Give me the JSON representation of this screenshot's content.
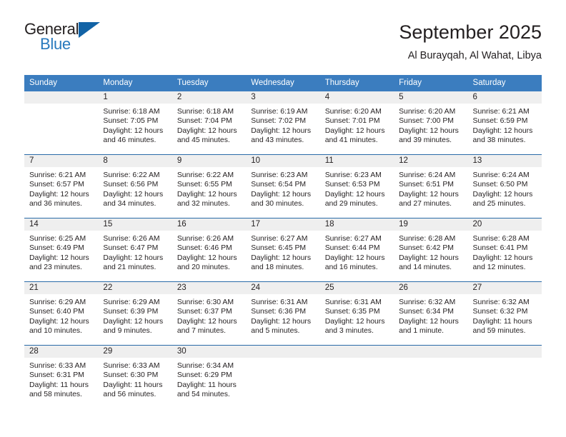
{
  "brand": {
    "name_part1": "General",
    "name_part2": "Blue",
    "logo_icon": "blue-triangle-icon",
    "colors": {
      "general_text": "#231f20",
      "blue_text": "#2879bd",
      "triangle": "#1263a6"
    }
  },
  "header": {
    "title": "September 2025",
    "subtitle": "Al Burayqah, Al Wahat, Libya"
  },
  "colors": {
    "header_row_bg": "#3b7dbf",
    "header_row_text": "#ffffff",
    "daynum_band_bg": "#efefef",
    "row_divider": "#2a6ba8",
    "body_text": "#231f20"
  },
  "weekday_headers": [
    "Sunday",
    "Monday",
    "Tuesday",
    "Wednesday",
    "Thursday",
    "Friday",
    "Saturday"
  ],
  "labels": {
    "sunrise_prefix": "Sunrise:",
    "sunset_prefix": "Sunset:",
    "daylight_prefix": "Daylight:"
  },
  "weeks": [
    [
      {
        "day": "",
        "empty": true
      },
      {
        "day": "1",
        "sunrise": "Sunrise: 6:18 AM",
        "sunset": "Sunset: 7:05 PM",
        "daylight_line1": "Daylight: 12 hours",
        "daylight_line2": "and 46 minutes."
      },
      {
        "day": "2",
        "sunrise": "Sunrise: 6:18 AM",
        "sunset": "Sunset: 7:04 PM",
        "daylight_line1": "Daylight: 12 hours",
        "daylight_line2": "and 45 minutes."
      },
      {
        "day": "3",
        "sunrise": "Sunrise: 6:19 AM",
        "sunset": "Sunset: 7:02 PM",
        "daylight_line1": "Daylight: 12 hours",
        "daylight_line2": "and 43 minutes."
      },
      {
        "day": "4",
        "sunrise": "Sunrise: 6:20 AM",
        "sunset": "Sunset: 7:01 PM",
        "daylight_line1": "Daylight: 12 hours",
        "daylight_line2": "and 41 minutes."
      },
      {
        "day": "5",
        "sunrise": "Sunrise: 6:20 AM",
        "sunset": "Sunset: 7:00 PM",
        "daylight_line1": "Daylight: 12 hours",
        "daylight_line2": "and 39 minutes."
      },
      {
        "day": "6",
        "sunrise": "Sunrise: 6:21 AM",
        "sunset": "Sunset: 6:59 PM",
        "daylight_line1": "Daylight: 12 hours",
        "daylight_line2": "and 38 minutes."
      }
    ],
    [
      {
        "day": "7",
        "sunrise": "Sunrise: 6:21 AM",
        "sunset": "Sunset: 6:57 PM",
        "daylight_line1": "Daylight: 12 hours",
        "daylight_line2": "and 36 minutes."
      },
      {
        "day": "8",
        "sunrise": "Sunrise: 6:22 AM",
        "sunset": "Sunset: 6:56 PM",
        "daylight_line1": "Daylight: 12 hours",
        "daylight_line2": "and 34 minutes."
      },
      {
        "day": "9",
        "sunrise": "Sunrise: 6:22 AM",
        "sunset": "Sunset: 6:55 PM",
        "daylight_line1": "Daylight: 12 hours",
        "daylight_line2": "and 32 minutes."
      },
      {
        "day": "10",
        "sunrise": "Sunrise: 6:23 AM",
        "sunset": "Sunset: 6:54 PM",
        "daylight_line1": "Daylight: 12 hours",
        "daylight_line2": "and 30 minutes."
      },
      {
        "day": "11",
        "sunrise": "Sunrise: 6:23 AM",
        "sunset": "Sunset: 6:53 PM",
        "daylight_line1": "Daylight: 12 hours",
        "daylight_line2": "and 29 minutes."
      },
      {
        "day": "12",
        "sunrise": "Sunrise: 6:24 AM",
        "sunset": "Sunset: 6:51 PM",
        "daylight_line1": "Daylight: 12 hours",
        "daylight_line2": "and 27 minutes."
      },
      {
        "day": "13",
        "sunrise": "Sunrise: 6:24 AM",
        "sunset": "Sunset: 6:50 PM",
        "daylight_line1": "Daylight: 12 hours",
        "daylight_line2": "and 25 minutes."
      }
    ],
    [
      {
        "day": "14",
        "sunrise": "Sunrise: 6:25 AM",
        "sunset": "Sunset: 6:49 PM",
        "daylight_line1": "Daylight: 12 hours",
        "daylight_line2": "and 23 minutes."
      },
      {
        "day": "15",
        "sunrise": "Sunrise: 6:26 AM",
        "sunset": "Sunset: 6:47 PM",
        "daylight_line1": "Daylight: 12 hours",
        "daylight_line2": "and 21 minutes."
      },
      {
        "day": "16",
        "sunrise": "Sunrise: 6:26 AM",
        "sunset": "Sunset: 6:46 PM",
        "daylight_line1": "Daylight: 12 hours",
        "daylight_line2": "and 20 minutes."
      },
      {
        "day": "17",
        "sunrise": "Sunrise: 6:27 AM",
        "sunset": "Sunset: 6:45 PM",
        "daylight_line1": "Daylight: 12 hours",
        "daylight_line2": "and 18 minutes."
      },
      {
        "day": "18",
        "sunrise": "Sunrise: 6:27 AM",
        "sunset": "Sunset: 6:44 PM",
        "daylight_line1": "Daylight: 12 hours",
        "daylight_line2": "and 16 minutes."
      },
      {
        "day": "19",
        "sunrise": "Sunrise: 6:28 AM",
        "sunset": "Sunset: 6:42 PM",
        "daylight_line1": "Daylight: 12 hours",
        "daylight_line2": "and 14 minutes."
      },
      {
        "day": "20",
        "sunrise": "Sunrise: 6:28 AM",
        "sunset": "Sunset: 6:41 PM",
        "daylight_line1": "Daylight: 12 hours",
        "daylight_line2": "and 12 minutes."
      }
    ],
    [
      {
        "day": "21",
        "sunrise": "Sunrise: 6:29 AM",
        "sunset": "Sunset: 6:40 PM",
        "daylight_line1": "Daylight: 12 hours",
        "daylight_line2": "and 10 minutes."
      },
      {
        "day": "22",
        "sunrise": "Sunrise: 6:29 AM",
        "sunset": "Sunset: 6:39 PM",
        "daylight_line1": "Daylight: 12 hours",
        "daylight_line2": "and 9 minutes."
      },
      {
        "day": "23",
        "sunrise": "Sunrise: 6:30 AM",
        "sunset": "Sunset: 6:37 PM",
        "daylight_line1": "Daylight: 12 hours",
        "daylight_line2": "and 7 minutes."
      },
      {
        "day": "24",
        "sunrise": "Sunrise: 6:31 AM",
        "sunset": "Sunset: 6:36 PM",
        "daylight_line1": "Daylight: 12 hours",
        "daylight_line2": "and 5 minutes."
      },
      {
        "day": "25",
        "sunrise": "Sunrise: 6:31 AM",
        "sunset": "Sunset: 6:35 PM",
        "daylight_line1": "Daylight: 12 hours",
        "daylight_line2": "and 3 minutes."
      },
      {
        "day": "26",
        "sunrise": "Sunrise: 6:32 AM",
        "sunset": "Sunset: 6:34 PM",
        "daylight_line1": "Daylight: 12 hours",
        "daylight_line2": "and 1 minute."
      },
      {
        "day": "27",
        "sunrise": "Sunrise: 6:32 AM",
        "sunset": "Sunset: 6:32 PM",
        "daylight_line1": "Daylight: 11 hours",
        "daylight_line2": "and 59 minutes."
      }
    ],
    [
      {
        "day": "28",
        "sunrise": "Sunrise: 6:33 AM",
        "sunset": "Sunset: 6:31 PM",
        "daylight_line1": "Daylight: 11 hours",
        "daylight_line2": "and 58 minutes."
      },
      {
        "day": "29",
        "sunrise": "Sunrise: 6:33 AM",
        "sunset": "Sunset: 6:30 PM",
        "daylight_line1": "Daylight: 11 hours",
        "daylight_line2": "and 56 minutes."
      },
      {
        "day": "30",
        "sunrise": "Sunrise: 6:34 AM",
        "sunset": "Sunset: 6:29 PM",
        "daylight_line1": "Daylight: 11 hours",
        "daylight_line2": "and 54 minutes."
      },
      {
        "day": "",
        "empty": true
      },
      {
        "day": "",
        "empty": true
      },
      {
        "day": "",
        "empty": true
      },
      {
        "day": "",
        "empty": true
      }
    ]
  ]
}
